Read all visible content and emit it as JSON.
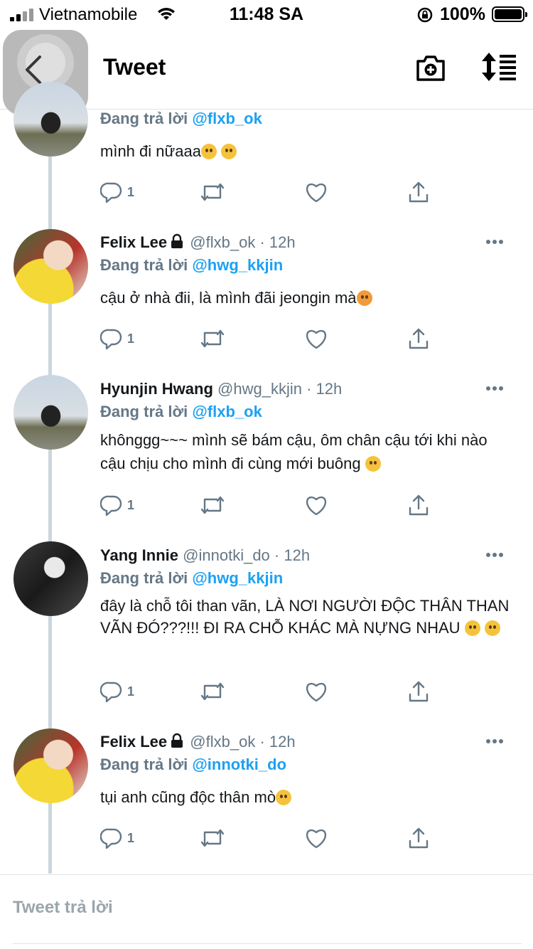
{
  "status_bar": {
    "carrier": "Vietnamobile",
    "time": "11:48 SA",
    "battery": "100%"
  },
  "header": {
    "title": "Tweet"
  },
  "reply_prefix": "Đang trả lời",
  "tweets": [
    {
      "name": "",
      "handle": "",
      "time": "",
      "replying_to": "@flxb_ok",
      "text": "mình đi nữaaa",
      "emoji": [
        "pleading-face",
        "pleading-face"
      ],
      "reply_count": "1"
    },
    {
      "name": "Felix Lee",
      "protected": true,
      "handle": "@flxb_ok",
      "time": "· 12h",
      "replying_to": "@hwg_kkjin",
      "text": "cậu ở nhà đii, là mình đãi jeongin mà",
      "emoji": [
        "angry-face"
      ],
      "reply_count": "1"
    },
    {
      "name": "Hyunjin Hwang",
      "protected": false,
      "handle": "@hwg_kkjin",
      "time": "· 12h",
      "replying_to": "@flxb_ok",
      "text": "khônggg~~~ mình sẽ bám cậu, ôm chân cậu tới khi nào cậu chịu cho mình đi cùng mới buông",
      "emoji": [
        "pleading-face"
      ],
      "reply_count": "1"
    },
    {
      "name": "Yang Innie",
      "protected": false,
      "handle": "@innotki_do",
      "time": "· 12h",
      "replying_to": "@hwg_kkjin",
      "text": "đây là chỗ tôi than vãn, LÀ NƠI NGƯỜI ĐỘC THÂN THAN VÃN ĐÓ???!!! ĐI RA CHỖ KHÁC MÀ NỰNG NHAU",
      "emoji": [
        "slightly-smiling-face",
        "slightly-smiling-face"
      ],
      "reply_count": "1"
    },
    {
      "name": "Felix Lee",
      "protected": true,
      "handle": "@flxb_ok",
      "time": "· 12h",
      "replying_to": "@innotki_do",
      "text": "tụi anh cũng độc thân mò",
      "emoji": [
        "pleading-face"
      ],
      "reply_count": "1"
    }
  ],
  "reply_box": {
    "placeholder": "Tweet trả lời"
  }
}
